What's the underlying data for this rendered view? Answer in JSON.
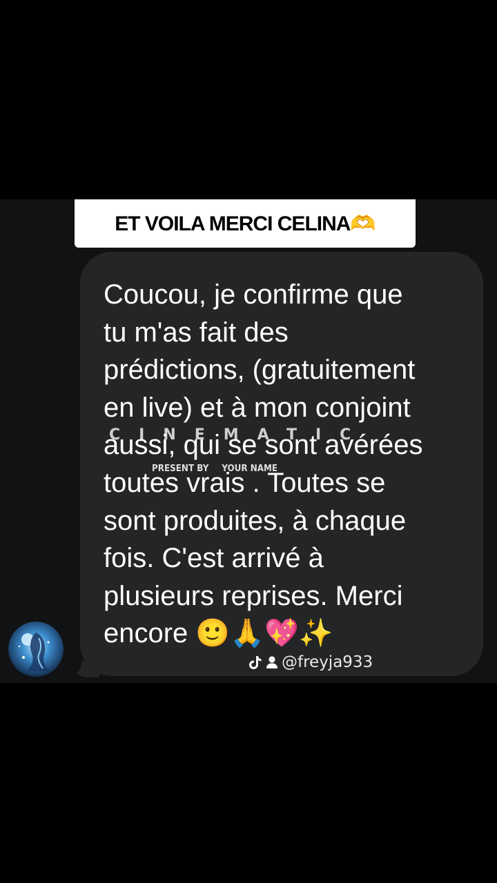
{
  "banner": {
    "text": "ET VOILA MERCI CELINA🫶"
  },
  "message": {
    "text": "Coucou, je confirme que\ntu m'as fait des\nprédictions, (gratuitement\nen live) et à mon conjoint\naussi, qui se sont avérées\ntoutes vrais  . Toutes se\nsont produites, à chaque\nfois. C'est arrivé à\nplusieurs reprises. Merci\nencore 🙂🙏💖✨"
  },
  "overlay": {
    "title": "CINEMATIC",
    "present_by": "PRESENT BY",
    "your_name": "YOUR NAME"
  },
  "avatar": {
    "icon": "avatar-fantasy-blue"
  },
  "watermark": {
    "handle": "@freyja933",
    "icons": [
      "tiktok-icon",
      "user-icon"
    ]
  },
  "colors": {
    "background": "#000000",
    "band": "#111213",
    "bubble": "#242527",
    "banner": "#ffffff",
    "text": "#ffffff"
  }
}
